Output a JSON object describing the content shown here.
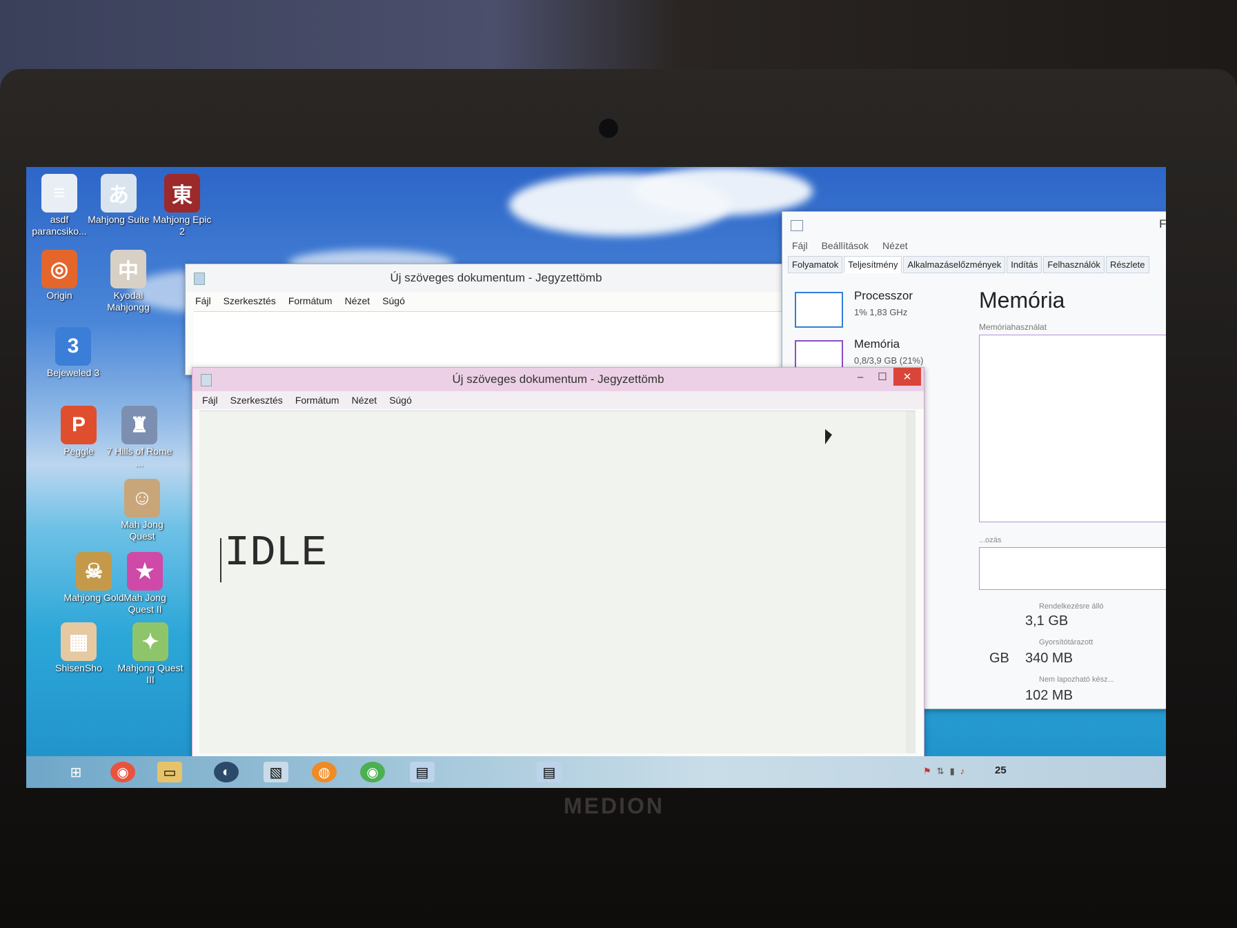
{
  "desktop_icons": [
    {
      "label": "asdf parancsiko...",
      "glyph": "≡",
      "color": "#e8eef4"
    },
    {
      "label": "Mahjong Suite",
      "glyph": "あ",
      "color": "#d9e4ef"
    },
    {
      "label": "Mahjong Epic 2",
      "glyph": "東",
      "color": "#9c2a2a"
    },
    {
      "label": "Origin",
      "glyph": "◎",
      "color": "#e5662b"
    },
    {
      "label": "Kyodai Mahjongg",
      "glyph": "中",
      "color": "#d8d0c4"
    },
    {
      "label": "Bejeweled 3",
      "glyph": "3",
      "color": "#3b7ed8"
    },
    {
      "label": "Peggle",
      "glyph": "P",
      "color": "#e04f2d"
    },
    {
      "label": "7 Hills of Rome ...",
      "glyph": "♜",
      "color": "#7d8fb0"
    },
    {
      "label": "Mah Jong Quest",
      "glyph": "☺",
      "color": "#c9a57a"
    },
    {
      "label": "Mahjong Gold",
      "glyph": "☠",
      "color": "#c49a4a"
    },
    {
      "label": "Mah Jong Quest II",
      "glyph": "★",
      "color": "#cf4aa8"
    },
    {
      "label": "ShisenSho",
      "glyph": "▦",
      "color": "#e6c9a1"
    },
    {
      "label": "Mahjong Quest III",
      "glyph": "✦",
      "color": "#8fc56a"
    }
  ],
  "notepad_back": {
    "title": "Új szöveges dokumentum - Jegyzettömb",
    "menu": [
      "Fájl",
      "Szerkesztés",
      "Formátum",
      "Nézet",
      "Súgó"
    ]
  },
  "notepad_front": {
    "title": "Új szöveges dokumentum - Jegyzettömb",
    "menu": [
      "Fájl",
      "Szerkesztés",
      "Formátum",
      "Nézet",
      "Súgó"
    ],
    "content": "IDLE",
    "minimize": "–",
    "maximize": "☐",
    "close": "✕"
  },
  "task_manager": {
    "title_fragment": "Fe",
    "menu": [
      "Fájl",
      "Beállítások",
      "Nézet"
    ],
    "tabs": [
      "Folyamatok",
      "Teljesítmény",
      "Alkalmazáselőzmények",
      "Indítás",
      "Felhasználók",
      "Részlete"
    ],
    "active_tab": "Teljesítmény",
    "processor_label": "Processzor",
    "processor_value": "1% 1,83 GHz",
    "memory_label": "Memória",
    "memory_value": "0,8/3,9 GB (21%)",
    "panel_title": "Memória",
    "panel_subtitle": "Memóriahasználat",
    "composition_label": "...ozás",
    "available_label": "Rendelkezésre álló",
    "available_value": "3,1 GB",
    "cached_label": "Gyorsítótárazott",
    "cached_value": "340 MB",
    "nonpaged_label": "Nem lapozható kész...",
    "nonpaged_value": "102 MB",
    "gb_fragment": "GB"
  },
  "taskbar": {
    "clock_fragment": "25",
    "icons": [
      "windows-logo-icon",
      "chrome-icon",
      "file-explorer-icon",
      "steam-icon",
      "paint-icon",
      "firefox-icon",
      "chrome-icon",
      "notepad-icon"
    ]
  },
  "laptop_brand": "MEDION"
}
